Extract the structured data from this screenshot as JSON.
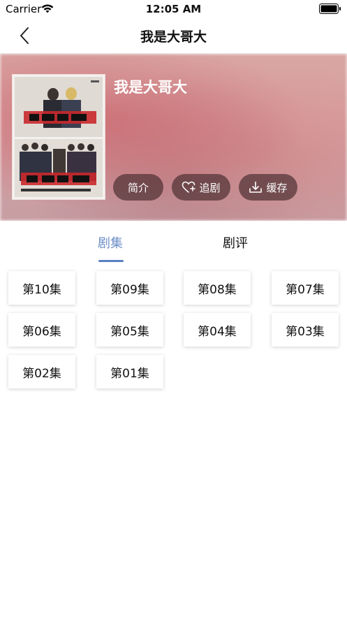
{
  "status_bar": {
    "carrier": "Carrier",
    "time": "12:05 AM"
  },
  "nav": {
    "title": "我是大哥大"
  },
  "header": {
    "show_title": "我是大哥大",
    "buttons": {
      "intro": "简介",
      "follow": "追剧",
      "cache": "缓存"
    }
  },
  "tabs": [
    {
      "label": "剧集",
      "active": true
    },
    {
      "label": "剧评",
      "active": false
    }
  ],
  "episodes": [
    "第10集",
    "第09集",
    "第08集",
    "第07集",
    "第06集",
    "第05集",
    "第04集",
    "第03集",
    "第02集",
    "第01集"
  ],
  "colors": {
    "accent": "#5b7fc4",
    "pill_bg": "#50323 4"
  }
}
